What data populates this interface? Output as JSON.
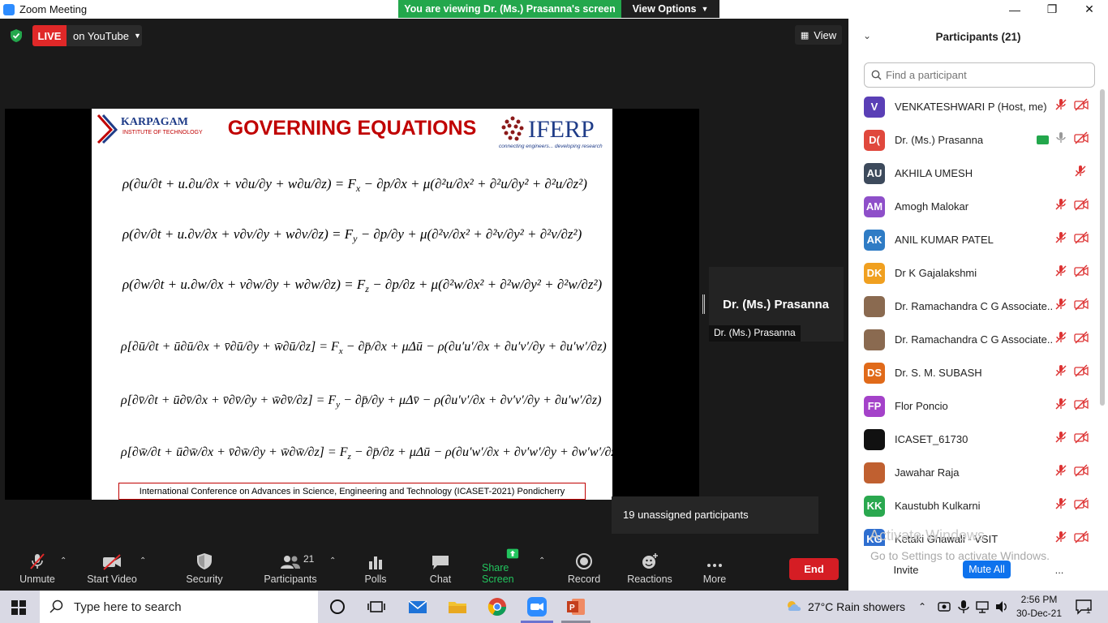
{
  "window": {
    "title": "Zoom Meeting"
  },
  "banner": {
    "text": "You are viewing Dr. (Ms.) Prasanna's screen",
    "view_options": "View Options"
  },
  "live": {
    "badge": "LIVE",
    "platform": "on YouTube"
  },
  "view_button": "View",
  "slide": {
    "title": "GOVERNING EQUATIONS",
    "logo_left": "KARPAGAM",
    "logo_left_sub": "INSTITUTE OF TECHNOLOGY",
    "logo_right": "IFERP",
    "logo_right_sub": "connecting engineers... developing research",
    "footer": "International Conference on Advances in Science, Engineering and Technology (ICASET-2021) Pondicherry"
  },
  "speaker": {
    "name_large": "Dr. (Ms.) Prasanna",
    "name_small": "Dr. (Ms.) Prasanna"
  },
  "tooltip": {
    "unassigned": "19 unassigned participants"
  },
  "toolbar": {
    "unmute": "Unmute",
    "start_video": "Start Video",
    "security": "Security",
    "participants": "Participants",
    "participants_count": "21",
    "polls": "Polls",
    "chat": "Chat",
    "share_screen": "Share Screen",
    "record": "Record",
    "reactions": "Reactions",
    "more": "More",
    "end": "End"
  },
  "panel": {
    "title": "Participants (21)",
    "search_placeholder": "Find a participant",
    "invite": "Invite",
    "mute_all": "Mute All",
    "more": "...",
    "participants": [
      {
        "initials": "V",
        "name": "VENKATESHWARI P (Host, me)",
        "color": "#5a3fb6"
      },
      {
        "initials": "D(",
        "name": "Dr. (Ms.) Prasanna",
        "color": "#e0483d"
      },
      {
        "initials": "AU",
        "name": "AKHILA UMESH",
        "color": "#3d4a5c"
      },
      {
        "initials": "AM",
        "name": "Amogh Malokar",
        "color": "#8e4fc9"
      },
      {
        "initials": "AK",
        "name": "ANIL KUMAR PATEL",
        "color": "#2f7cc5"
      },
      {
        "initials": "DK",
        "name": "Dr K Gajalakshmi",
        "color": "#f0a020"
      },
      {
        "initials": "",
        "name": "Dr. Ramachandra C G Associate...",
        "color": "#8a6a50"
      },
      {
        "initials": "",
        "name": "Dr. Ramachandra C G Associate...",
        "color": "#8a6a50"
      },
      {
        "initials": "DS",
        "name": "Dr. S. M. SUBASH",
        "color": "#e06a1a"
      },
      {
        "initials": "FP",
        "name": "Flor Poncio",
        "color": "#a442c9"
      },
      {
        "initials": "",
        "name": "ICASET_61730",
        "color": "#111111"
      },
      {
        "initials": "",
        "name": "Jawahar Raja",
        "color": "#c06030"
      },
      {
        "initials": "KK",
        "name": "Kaustubh Kulkarni",
        "color": "#2aa84f"
      },
      {
        "initials": "KG",
        "name": "Ketaki Ghawali - VSIT",
        "color": "#2f6fd0"
      }
    ]
  },
  "watermark": {
    "line1": "Activate Windows",
    "line2": "Go to Settings to activate Windows."
  },
  "taskbar": {
    "search_placeholder": "Type here to search",
    "weather": "27°C  Rain showers",
    "time": "2:56 PM",
    "date": "30-Dec-21",
    "notifications": "1"
  }
}
